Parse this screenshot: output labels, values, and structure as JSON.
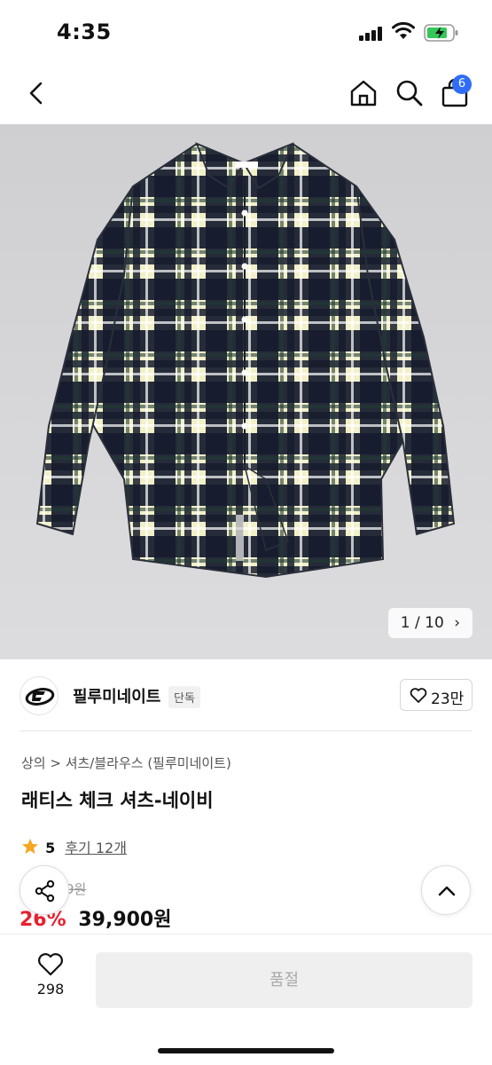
{
  "status_bar": {
    "time": "4:35"
  },
  "nav": {
    "cart_count": "6"
  },
  "gallery": {
    "counter": "1 / 10"
  },
  "brand": {
    "name": "필루미네이트",
    "tag": "단독",
    "like_count": "23만"
  },
  "product": {
    "breadcrumb": "상의 > 셔츠/블라우스 (필루미네이트)",
    "title": "래티스 체크 셔츠-네이비",
    "rating_score": "5",
    "review_text": "후기 12개",
    "original_price": "9원",
    "discount": "26%",
    "price": "39,900원"
  },
  "bottom_bar": {
    "wish_count": "298",
    "buy_label": "품절"
  },
  "colors": {
    "accent": "#2f6df6",
    "discount": "#e8212e",
    "star": "#f5a623"
  }
}
